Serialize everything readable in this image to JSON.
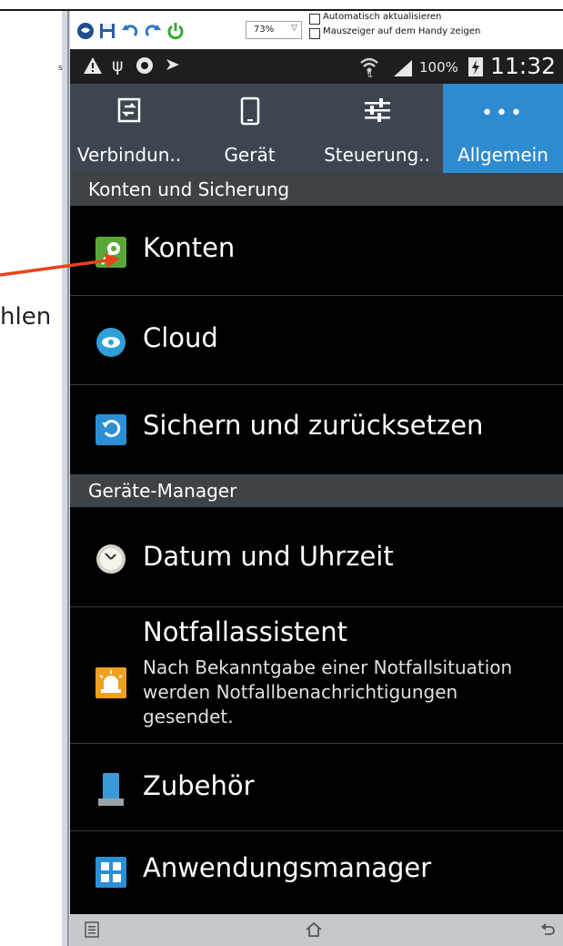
{
  "left_page": {
    "cut_text_top": "s",
    "cut_text_hlen": "hlen"
  },
  "toolbar": {
    "zoom_value": "73%",
    "checkbox_auto_refresh": "Automatisch aktualisieren",
    "checkbox_show_pointer": "Mauszeiger auf dem Handy zeigen",
    "icons": [
      "web-icon",
      "save-icon",
      "undo-icon",
      "redo-icon",
      "power-icon"
    ]
  },
  "status_bar": {
    "battery": "100%",
    "time": "11:32",
    "icons": [
      "warning-icon",
      "usb-icon",
      "sync-icon",
      "flag-icon",
      "wifi-icon",
      "signal-icon",
      "battery-charging-icon"
    ]
  },
  "tabs": [
    {
      "label": "Verbindun..",
      "icon": "connections-icon"
    },
    {
      "label": "Gerät",
      "icon": "device-icon"
    },
    {
      "label": "Steuerung..",
      "icon": "controls-icon"
    },
    {
      "label": "Allgemein",
      "icon": "more-dots-icon",
      "active": true
    }
  ],
  "sections": {
    "accounts_backup": "Konten und Sicherung",
    "device_manager": "Geräte-Manager"
  },
  "items": {
    "konten": "Konten",
    "cloud": "Cloud",
    "backup": "Sichern und zurücksetzen",
    "datetime": "Datum und Uhrzeit",
    "emergency_title": "Notfallassistent",
    "emergency_sub": "Nach Bekanntgabe einer Notfallsituation werden Notfallbenachrichtigungen gesendet.",
    "accessories": "Zubehör",
    "app_manager": "Anwendungsmanager"
  },
  "colors": {
    "active_tab": "#2f8bd0",
    "tab_bar": "#3d4650",
    "section_header": "#3e4348",
    "arrow": "#e8431c"
  }
}
